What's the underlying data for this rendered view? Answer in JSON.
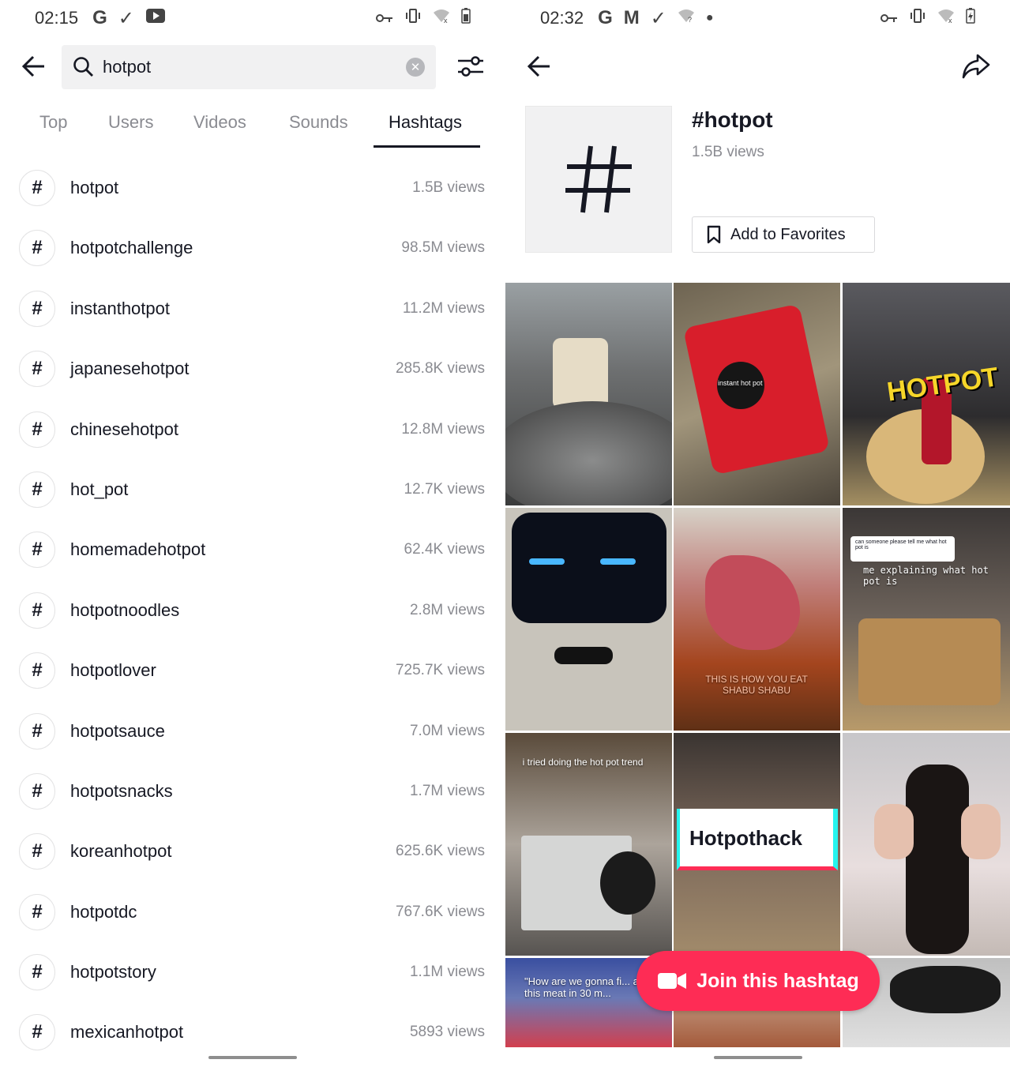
{
  "left": {
    "status": {
      "time": "02:15",
      "icons": [
        "google-icon",
        "check-icon",
        "youtube-icon"
      ],
      "right_icons": [
        "vpn-key-icon",
        "vibrate-icon",
        "wifi-off-icon",
        "battery-icon"
      ]
    },
    "search": {
      "value": "hotpot"
    },
    "tabs": [
      "Top",
      "Users",
      "Videos",
      "Sounds",
      "Hashtags"
    ],
    "active_tab": "Hashtags",
    "hashtags": [
      {
        "name": "hotpot",
        "views": "1.5B views"
      },
      {
        "name": "hotpotchallenge",
        "views": "98.5M views"
      },
      {
        "name": "instanthotpot",
        "views": "11.2M views"
      },
      {
        "name": "japanesehotpot",
        "views": "285.8K views"
      },
      {
        "name": "chinesehotpot",
        "views": "12.8M views"
      },
      {
        "name": "hot_pot",
        "views": "12.7K views"
      },
      {
        "name": "homemadehotpot",
        "views": "62.4K views"
      },
      {
        "name": "hotpotnoodles",
        "views": "2.8M views"
      },
      {
        "name": "hotpotlover",
        "views": "725.7K views"
      },
      {
        "name": "hotpotsauce",
        "views": "7.0M views"
      },
      {
        "name": "hotpotsnacks",
        "views": "1.7M views"
      },
      {
        "name": "koreanhotpot",
        "views": "625.6K views"
      },
      {
        "name": "hotpotdc",
        "views": "767.6K views"
      },
      {
        "name": "hotpotstory",
        "views": "1.1M views"
      },
      {
        "name": "mexicanhotpot",
        "views": "5893 views"
      }
    ]
  },
  "right": {
    "status": {
      "time": "02:32"
    },
    "title": "#hotpot",
    "views": "1.5B views",
    "favorites_label": "Add to Favorites",
    "join_label": "Join this hashtag",
    "video_captions": [
      "",
      "instant hot pot",
      "HOTPOT",
      "",
      "THIS IS HOW YOU EAT SHABU SHABU",
      "can someone please tell me what hot pot is",
      "me explaining what hot pot is",
      "i tried doing the hot pot trend",
      "Hotpothack",
      "",
      "\"How are we gonna fi... all of this meat in 30 m...",
      "",
      ""
    ],
    "accent_color": "#fe2c55"
  }
}
